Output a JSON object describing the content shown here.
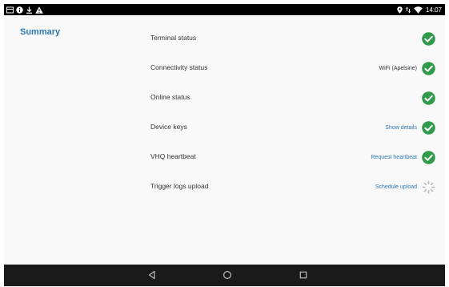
{
  "status_bar": {
    "time": "14:07",
    "icons_left": [
      "notification-card-icon",
      "info-icon",
      "download-icon",
      "warning-icon"
    ],
    "icons_right": [
      "location-icon",
      "data-arrows-icon",
      "wifi-icon"
    ]
  },
  "colors": {
    "accent": "#2e77b1",
    "success": "#2f9a4a",
    "pending": "#b5b5b5",
    "status_bar": "#000000",
    "nav_bar": "#1a1a1a",
    "background": "#f9f9f9"
  },
  "sidebar": {
    "title": "Summary"
  },
  "rows": [
    {
      "label": "Terminal status",
      "value": "",
      "link": "",
      "icon": "check-icon"
    },
    {
      "label": "Connectivity status",
      "value": "WiFi (Apelsine)",
      "link": "",
      "icon": "check-icon"
    },
    {
      "label": "Online status",
      "value": "",
      "link": "",
      "icon": "check-icon"
    },
    {
      "label": "Device keys",
      "value": "",
      "link": "Show details",
      "icon": "check-icon"
    },
    {
      "label": "VHQ heartbeat",
      "value": "",
      "link": "Request heartbeat",
      "icon": "check-icon"
    },
    {
      "label": "Trigger logs upload",
      "value": "",
      "link": "Schedule upload",
      "icon": "loading-spinner-icon"
    }
  ],
  "nav_bar": {
    "buttons": [
      "back-icon",
      "home-icon",
      "recents-icon"
    ]
  }
}
